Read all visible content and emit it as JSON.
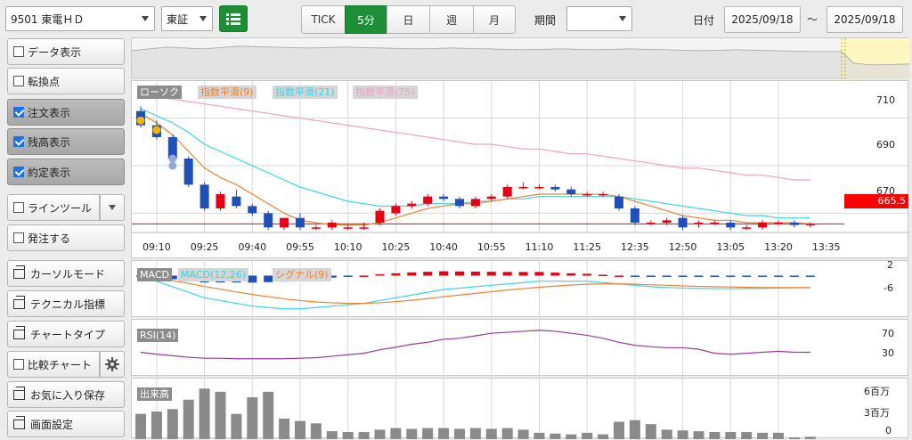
{
  "toolbar": {
    "symbol": "9501 東電ＨＤ",
    "market": "東証",
    "tabs": [
      "TICK",
      "5分",
      "日",
      "週",
      "月"
    ],
    "active_tab": "5分",
    "period_label": "期間",
    "period_value": "",
    "date_label": "日付",
    "date_from": "2025/09/18",
    "date_sep": "～",
    "date_to": "2025/09/18"
  },
  "sidebar": {
    "data_view": "データ表示",
    "turn_point": "転換点",
    "order_view": "注文表示",
    "balance_view": "残高表示",
    "exec_view": "約定表示",
    "line_tool": "ラインツール",
    "order": "発注する",
    "cursor_mode": "カーソルモード",
    "technical": "テクニカル指標",
    "chart_type": "チャートタイプ",
    "compare": "比較チャート",
    "favorite": "お気に入り保存",
    "screen": "画面設定"
  },
  "colors": {
    "up": "#e60012",
    "down": "#1f4fb8",
    "ema9": "#f08030",
    "ema21": "#38d4e8",
    "ema75": "#f0a0c0",
    "rsi": "#9b3b9b",
    "volume": "#8a8a8a",
    "accent_green": "#1e8f37",
    "current_price": "#ff0000"
  },
  "main_chart": {
    "legend": [
      "ローソク",
      "指数平滑(9)",
      "指数平滑(21)",
      "指数平滑(75)"
    ],
    "y_ticks": [
      "710",
      "690",
      "670"
    ],
    "current_price": "665.5",
    "x_ticks": [
      "09:10",
      "09:25",
      "09:40",
      "09:55",
      "10:10",
      "10:25",
      "10:40",
      "10:55",
      "11:10",
      "11:25",
      "12:35",
      "12:50",
      "13:05",
      "13:20",
      "13:35"
    ]
  },
  "macd": {
    "legend": [
      "MACD",
      "MACD(12,26)",
      "シグナル(9)"
    ],
    "y_ticks": [
      "2",
      "-6"
    ]
  },
  "rsi": {
    "legend": "RSI(14)",
    "y_ticks": [
      "70",
      "30"
    ]
  },
  "volume": {
    "legend": "出来高",
    "y_ticks": [
      "6百万",
      "3百万",
      "0"
    ]
  },
  "chart_data": {
    "type": "candlestick",
    "x": [
      "09:05",
      "09:10",
      "09:15",
      "09:20",
      "09:25",
      "09:30",
      "09:35",
      "09:40",
      "09:45",
      "09:50",
      "09:55",
      "10:00",
      "10:05",
      "10:10",
      "10:15",
      "10:20",
      "10:25",
      "10:30",
      "10:35",
      "10:40",
      "10:45",
      "10:50",
      "10:55",
      "11:00",
      "11:05",
      "11:10",
      "11:15",
      "11:20",
      "11:25",
      "11:30",
      "12:35",
      "12:40",
      "12:45",
      "12:50",
      "12:55",
      "13:00",
      "13:05",
      "13:10",
      "13:15",
      "13:20",
      "13:25",
      "13:30",
      "13:35"
    ],
    "candles": [
      {
        "o": 713,
        "c": 707,
        "h": 715,
        "l": 706
      },
      {
        "o": 707,
        "c": 702,
        "h": 709,
        "l": 701
      },
      {
        "o": 702,
        "c": 693,
        "h": 703,
        "l": 692
      },
      {
        "o": 693,
        "c": 682,
        "h": 694,
        "l": 681
      },
      {
        "o": 682,
        "c": 672,
        "h": 683,
        "l": 671
      },
      {
        "o": 672,
        "c": 678,
        "h": 679,
        "l": 671
      },
      {
        "o": 677,
        "c": 673,
        "h": 680,
        "l": 672
      },
      {
        "o": 673,
        "c": 670,
        "h": 674,
        "l": 669
      },
      {
        "o": 670,
        "c": 664,
        "h": 671,
        "l": 663
      },
      {
        "o": 664,
        "c": 668,
        "h": 668,
        "l": 663
      },
      {
        "o": 668,
        "c": 664,
        "h": 670,
        "l": 663
      },
      {
        "o": 664,
        "c": 664,
        "h": 665,
        "l": 663
      },
      {
        "o": 664,
        "c": 666,
        "h": 667,
        "l": 663
      },
      {
        "o": 664,
        "c": 664,
        "h": 665,
        "l": 663
      },
      {
        "o": 664,
        "c": 664,
        "h": 666,
        "l": 663
      },
      {
        "o": 666,
        "c": 671,
        "h": 672,
        "l": 665
      },
      {
        "o": 670,
        "c": 673,
        "h": 674,
        "l": 669
      },
      {
        "o": 673,
        "c": 674,
        "h": 675,
        "l": 672
      },
      {
        "o": 674,
        "c": 677,
        "h": 678,
        "l": 673
      },
      {
        "o": 677,
        "c": 676,
        "h": 678,
        "l": 675
      },
      {
        "o": 676,
        "c": 673,
        "h": 677,
        "l": 672
      },
      {
        "o": 673,
        "c": 676,
        "h": 677,
        "l": 672
      },
      {
        "o": 676,
        "c": 677,
        "h": 678,
        "l": 675
      },
      {
        "o": 677,
        "c": 681,
        "h": 682,
        "l": 676
      },
      {
        "o": 681,
        "c": 681,
        "h": 683,
        "l": 680
      },
      {
        "o": 681,
        "c": 681,
        "h": 682,
        "l": 680
      },
      {
        "o": 681,
        "c": 680,
        "h": 682,
        "l": 679
      },
      {
        "o": 680,
        "c": 678,
        "h": 681,
        "l": 677
      },
      {
        "o": 678,
        "c": 678,
        "h": 679,
        "l": 677
      },
      {
        "o": 678,
        "c": 678,
        "h": 679,
        "l": 677
      },
      {
        "o": 677,
        "c": 672,
        "h": 678,
        "l": 671
      },
      {
        "o": 672,
        "c": 666,
        "h": 673,
        "l": 665
      },
      {
        "o": 666,
        "c": 666,
        "h": 667,
        "l": 665
      },
      {
        "o": 666,
        "c": 667,
        "h": 668,
        "l": 665
      },
      {
        "o": 668,
        "c": 664,
        "h": 669,
        "l": 663
      },
      {
        "o": 666,
        "c": 666,
        "h": 667,
        "l": 664
      },
      {
        "o": 666,
        "c": 666,
        "h": 667,
        "l": 665
      },
      {
        "o": 666,
        "c": 664,
        "h": 667,
        "l": 663
      },
      {
        "o": 664,
        "c": 664,
        "h": 665,
        "l": 663
      },
      {
        "o": 664,
        "c": 666,
        "h": 667,
        "l": 663
      },
      {
        "o": 666,
        "c": 666,
        "h": 667,
        "l": 665
      },
      {
        "o": 666,
        "c": 665,
        "h": 667,
        "l": 664
      },
      {
        "o": 665,
        "c": 665.5,
        "h": 666,
        "l": 664
      }
    ],
    "ema9": [
      712,
      708,
      703,
      696,
      689,
      685,
      682,
      678,
      674,
      670,
      667,
      666,
      665,
      665,
      665,
      666,
      668,
      670,
      672,
      673,
      674,
      674,
      675,
      676,
      677,
      678,
      678,
      678,
      678,
      678,
      677,
      675,
      673,
      671,
      669,
      668,
      667,
      667,
      666,
      666,
      666,
      666,
      665.5
    ],
    "ema21": [
      714,
      711,
      708,
      704,
      699,
      696,
      693,
      690,
      687,
      684,
      681,
      679,
      677,
      675,
      674,
      673,
      673,
      673,
      674,
      674,
      674,
      675,
      675,
      676,
      676,
      677,
      677,
      677,
      677,
      677,
      677,
      676,
      675,
      674,
      673,
      672,
      671,
      670,
      669,
      669,
      668,
      668,
      668
    ],
    "ema75": [
      720,
      719,
      718,
      717,
      716,
      715,
      714,
      713,
      712,
      711,
      710,
      709,
      708,
      707,
      706,
      705,
      704,
      703,
      702,
      701,
      700,
      699,
      699,
      698,
      697,
      697,
      696,
      695,
      695,
      694,
      693,
      692,
      691,
      690,
      689,
      689,
      688,
      687,
      686,
      686,
      685,
      684,
      684
    ],
    "macd": [
      -1,
      -2,
      -4,
      -6,
      -8,
      -9,
      -10,
      -11,
      -11.5,
      -12,
      -12,
      -11.5,
      -11,
      -10.5,
      -10,
      -9,
      -8,
      -7,
      -6,
      -5,
      -4.5,
      -4,
      -3.5,
      -3,
      -2.5,
      -2,
      -2,
      -2,
      -2,
      -2.5,
      -3,
      -3.5,
      -4,
      -4.3,
      -4.5,
      -4.6,
      -4.7,
      -4.7,
      -4.6,
      -4.6,
      -4.5,
      -4.4,
      -4.4
    ],
    "signal": [
      -0.5,
      -1,
      -1.8,
      -2.8,
      -3.9,
      -4.9,
      -5.9,
      -6.8,
      -7.6,
      -8.4,
      -9,
      -9.5,
      -9.8,
      -10,
      -10,
      -9.8,
      -9.4,
      -8.9,
      -8.3,
      -7.6,
      -7,
      -6.4,
      -5.8,
      -5.2,
      -4.7,
      -4.2,
      -3.8,
      -3.4,
      -3.1,
      -3,
      -3,
      -3.1,
      -3.3,
      -3.5,
      -3.7,
      -3.9,
      -4,
      -4.1,
      -4.2,
      -4.3,
      -4.3,
      -4.3,
      -4.3
    ],
    "rsi": [
      22,
      18,
      15,
      12,
      10,
      10,
      9,
      9,
      9,
      9,
      10,
      11,
      14,
      17,
      20,
      27,
      32,
      38,
      42,
      48,
      50,
      55,
      60,
      62,
      64,
      66,
      64,
      60,
      56,
      50,
      42,
      36,
      33,
      31,
      31,
      28,
      20,
      18,
      20,
      22,
      24,
      22,
      22
    ],
    "volume": [
      3.2,
      3.5,
      3.8,
      5.0,
      6.4,
      6.0,
      3.2,
      5.3,
      6.0,
      2.6,
      2.3,
      2.0,
      1.0,
      0.9,
      0.9,
      1.2,
      1.4,
      1.3,
      1.4,
      1.4,
      1.3,
      1.4,
      1.3,
      1.4,
      1.2,
      0.8,
      0.7,
      0.6,
      0.8,
      0.6,
      2.2,
      2.4,
      1.9,
      1.2,
      1.1,
      1.0,
      0.9,
      0.9,
      0.9,
      0.8,
      0.8,
      0.2,
      0.3
    ],
    "ylim_price": [
      660,
      720
    ],
    "ylim_macd": [
      -14,
      4
    ],
    "ylim_rsi": [
      0,
      100
    ],
    "ylim_volume": [
      0,
      7
    ]
  }
}
